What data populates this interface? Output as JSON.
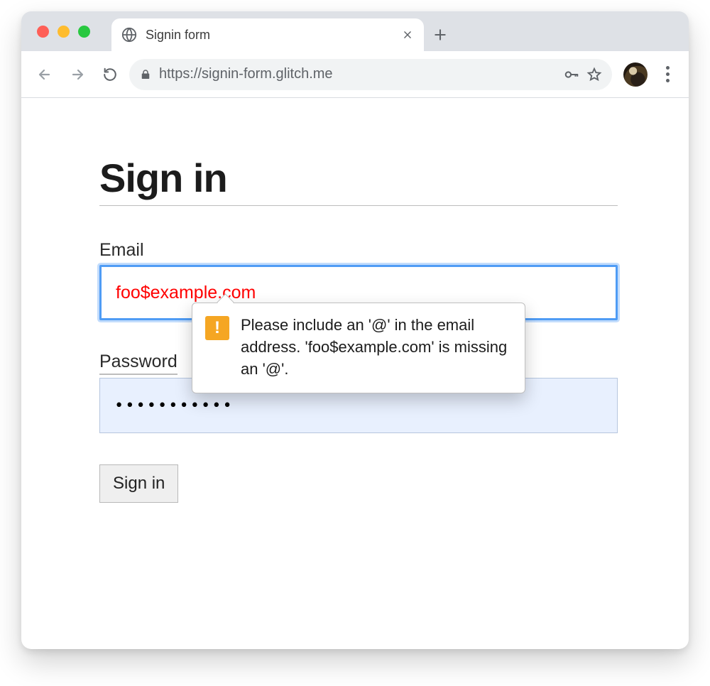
{
  "browser": {
    "tab_title": "Signin form",
    "url": "https://signin-form.glitch.me"
  },
  "page": {
    "heading": "Sign in",
    "email": {
      "label": "Email",
      "value": "foo$example.com"
    },
    "password": {
      "label": "Password",
      "value": "•••••••••••"
    },
    "submit_label": "Sign in",
    "validation_message": "Please include an '@' in the email address. 'foo$example.com' is missing an '@'."
  }
}
